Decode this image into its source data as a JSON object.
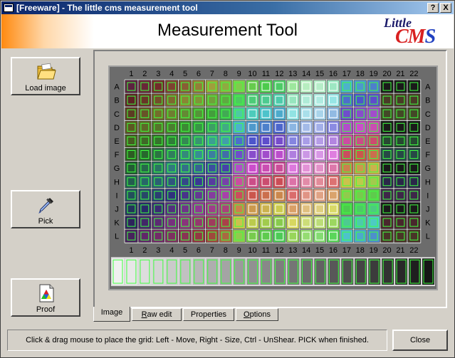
{
  "window": {
    "title": "[Freeware] - The little cms measurement tool",
    "help_label": "?",
    "close_label": "X"
  },
  "header": {
    "title": "Measurement Tool",
    "logo_word1": "Little",
    "logo_word2_a": "CM",
    "logo_word2_b": "S"
  },
  "sidebar": {
    "load_label": "Load image",
    "pick_label": "Pick",
    "proof_label": "Proof"
  },
  "target": {
    "column_labels": [
      "1",
      "2",
      "3",
      "4",
      "5",
      "6",
      "7",
      "8",
      "9",
      "10",
      "11",
      "12",
      "13",
      "14",
      "15",
      "16",
      "17",
      "18",
      "19",
      "20",
      "21",
      "22"
    ],
    "row_labels": [
      "A",
      "B",
      "C",
      "D",
      "E",
      "F",
      "G",
      "H",
      "I",
      "J",
      "K",
      "L"
    ]
  },
  "tabs": [
    {
      "label": "Image",
      "active": true
    },
    {
      "label_u": "R",
      "label_rest": "aw edit",
      "active": false
    },
    {
      "label": "Properties",
      "active": false
    },
    {
      "label_u": "O",
      "label_rest": "ptions",
      "active": false
    }
  ],
  "status": "Click & drag mouse to place the grid: Left - Move, Right - Size, Ctrl - UnShear. PICK when finished.",
  "close_button": "Close",
  "colors": {
    "title_bar": "#0a246a",
    "accent_orange": "#ff8a10",
    "grid_green": "#40ff40",
    "grid_white": "#ffffff",
    "frame_yellow": "#e6dc50"
  },
  "icons": [
    "folder-icon",
    "eyedropper-icon",
    "proof-document-icon"
  ]
}
